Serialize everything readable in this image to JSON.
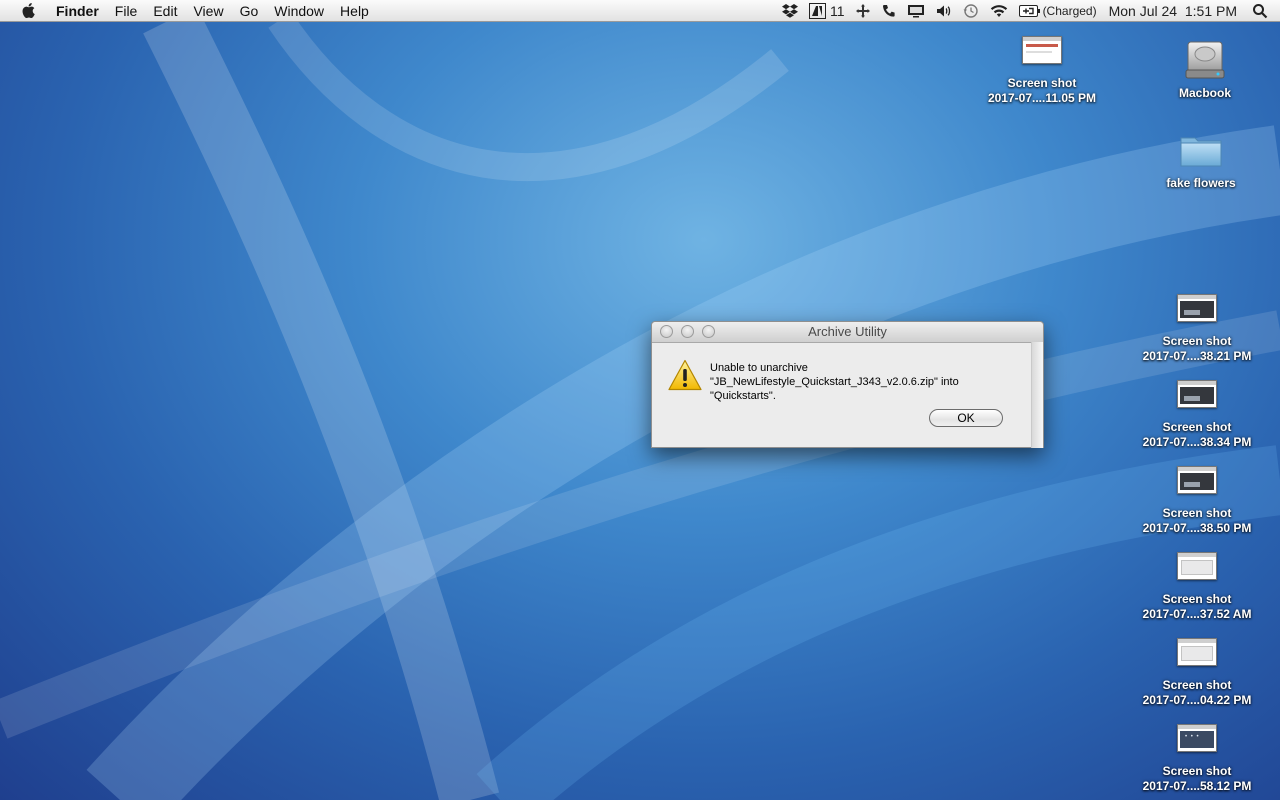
{
  "menubar": {
    "app_name": "Finder",
    "menus": [
      "File",
      "Edit",
      "View",
      "Go",
      "Window",
      "Help"
    ],
    "status": {
      "adobe_count": "11",
      "battery_text": "(Charged)",
      "clock": "Mon Jul 24  1:51 PM"
    }
  },
  "desktop_icons": [
    {
      "label_line1": "Screen shot",
      "label_line2": "2017-07....11.05 PM",
      "thumb_style": "red"
    },
    {
      "label_line1": "Macbook",
      "icon": "hard-drive-icon"
    },
    {
      "label_line1": "fake flowers",
      "icon": "folder-icon"
    },
    {
      "label_line1": "Screen shot",
      "label_line2": "2017-07....38.21 PM",
      "thumb_style": "dark"
    },
    {
      "label_line1": "Screen shot",
      "label_line2": "2017-07....38.34 PM",
      "thumb_style": "dark"
    },
    {
      "label_line1": "Screen shot",
      "label_line2": "2017-07....38.50 PM",
      "thumb_style": "dark"
    },
    {
      "label_line1": "Screen shot",
      "label_line2": "2017-07....37.52 AM",
      "thumb_style": "light"
    },
    {
      "label_line1": "Screen shot",
      "label_line2": "2017-07....04.22 PM",
      "thumb_style": "light"
    },
    {
      "label_line1": "Screen shot",
      "label_line2": "2017-07....58.12 PM",
      "thumb_style": "navy"
    }
  ],
  "dialog": {
    "title": "Archive Utility",
    "message_line1": "Unable to unarchive",
    "message_line2": "\"JB_NewLifestyle_Quickstart_J343_v2.0.6.zip\" into",
    "message_line3": "\"Quickstarts\".",
    "ok_label": "OK",
    "icon": "warning-icon"
  },
  "colors": {
    "accent_warning": "#f5c400",
    "desktop_blue": "#2a63b0"
  }
}
